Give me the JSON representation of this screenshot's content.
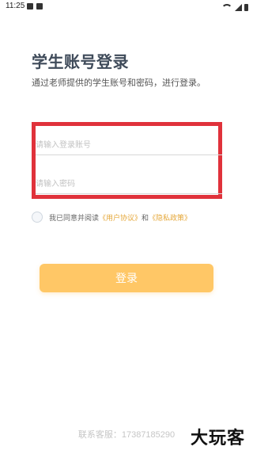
{
  "status_bar": {
    "time": "11:25"
  },
  "header": {
    "title": "学生账号登录",
    "subtitle": "通过老师提供的学生账号和密码，进行登录。"
  },
  "form": {
    "account_placeholder": "请输入登录账号",
    "password_placeholder": "请输入密码",
    "agreement_prefix": "我已同意并阅读",
    "user_agreement_link": "《用户协议》",
    "and_text": "和",
    "privacy_policy_link": "《隐私政策》",
    "login_button_label": "登录"
  },
  "footer": {
    "support_text": "联系客服：17387185290"
  },
  "watermark": {
    "text": "大玩客"
  },
  "colors": {
    "accent": "#ffc766",
    "link": "#e5a83b",
    "highlight_box": "#e0323b"
  }
}
